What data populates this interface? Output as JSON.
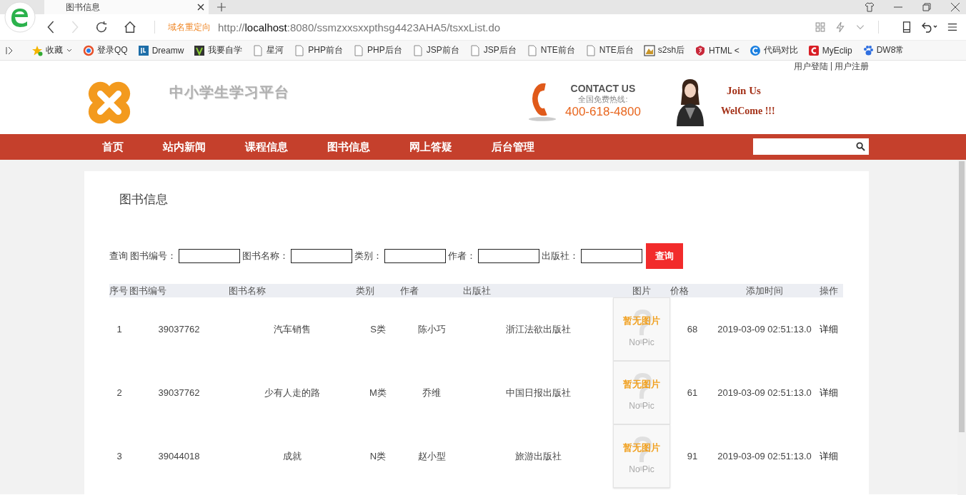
{
  "browser": {
    "tab_title": "图书信息",
    "redirect_label": "域名重定向",
    "url_prefix": "http://",
    "url_host": "localhost",
    "url_rest": ":8080/ssmzxxsxxpthsg4423AHA5/tsxxList.do",
    "bookmarks": [
      {
        "label": "收藏",
        "kind": "star"
      },
      {
        "label": "登录QQ",
        "kind": "qq"
      },
      {
        "label": "Dreamw",
        "kind": "dw"
      },
      {
        "label": "我要自学",
        "kind": "v"
      },
      {
        "label": "星河",
        "kind": "page"
      },
      {
        "label": "PHP前台",
        "kind": "page"
      },
      {
        "label": "PHP后台",
        "kind": "page"
      },
      {
        "label": "JSP前台",
        "kind": "page"
      },
      {
        "label": "JSP后台",
        "kind": "page"
      },
      {
        "label": "NTE前台",
        "kind": "page"
      },
      {
        "label": "NTE后台",
        "kind": "page"
      },
      {
        "label": "s2sh后",
        "kind": "pic"
      },
      {
        "label": "HTML <",
        "kind": "html"
      },
      {
        "label": "代码对比",
        "kind": "c"
      },
      {
        "label": "MyEclip",
        "kind": "me"
      },
      {
        "label": "DW8常",
        "kind": "paw"
      }
    ]
  },
  "header": {
    "user_links": [
      "用户登陆",
      "用户注册"
    ],
    "link_separator": "|",
    "site_title": "中小学生学习平台",
    "contact_title": "CONTACT US",
    "hotline_label": "全国免费热线:",
    "hotline": "400-618-4800",
    "join": "Join Us",
    "welcome": "WelCome !!!"
  },
  "nav": {
    "items": [
      "首页",
      "站内新闻",
      "课程信息",
      "图书信息",
      "网上答疑",
      "后台管理"
    ]
  },
  "panel": {
    "title": "图书信息",
    "search": {
      "label": "查询",
      "fields": [
        "图书编号：",
        "图书名称：",
        "类别：",
        "作者：",
        "出版社："
      ],
      "button": "查询"
    },
    "table": {
      "columns": [
        "序号",
        "图书编号",
        "图书名称",
        "类别",
        "作者",
        "出版社",
        "图片",
        "价格",
        "添加时间",
        "操作"
      ],
      "rows": [
        {
          "index": "1",
          "code": "39037762",
          "name": "汽车销售",
          "category": "S类",
          "author": "陈小巧",
          "publisher": "浙江法欲出版社",
          "image": {
            "cn": "暂无图片",
            "en": "No Pic"
          },
          "price": "68",
          "added": "2019-03-09 02:51:13.0",
          "action": "详细"
        },
        {
          "index": "2",
          "code": "39037762",
          "name": "少有人走的路",
          "category": "M类",
          "author": "乔维",
          "publisher": "中国日报出版社",
          "image": {
            "cn": "暂无图片",
            "en": "No Pic"
          },
          "price": "61",
          "added": "2019-03-09 02:51:13.0",
          "action": "详细"
        },
        {
          "index": "3",
          "code": "39044018",
          "name": "成就",
          "category": "N类",
          "author": "赵小型",
          "publisher": "旅游出版社",
          "image": {
            "cn": "暂无图片",
            "en": "No Pic"
          },
          "price": "91",
          "added": "2019-03-09 02:51:13.0",
          "action": "详细"
        }
      ]
    }
  }
}
